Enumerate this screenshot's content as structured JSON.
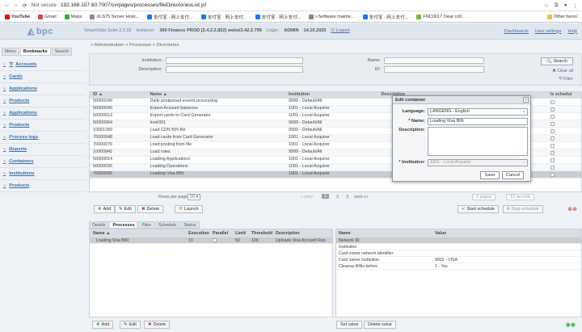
{
  "browser": {
    "warn": "Not secure",
    "url": "192.168.157.60:7007/sv/pages/processes/fileDirectoriesList.jsf",
    "other": "Other favori"
  },
  "bookmarks": [
    "YouTube",
    "Gmail",
    "Maps",
    "XLS75 Server Host...",
    "支付宝 · 网上支付...",
    "支付宝 · 网上支付...",
    "支付宝 · 网上支付...",
    "i-Software mainte...",
    "支付宝 · 网上支付...",
    "FNC0017 Dear coll..."
  ],
  "header": {
    "logo": "bpc",
    "suite": "SmartVista Suite 2.2.22",
    "instance_l": "Instance:",
    "instance": "360 Finance PROD [2.4.2.2.822] webs/2.42.2.795",
    "login_l": "Login:",
    "login": "ADMIN",
    "date": "14.10.2025",
    "logout": "Logout",
    "dashboards": "Dashboards",
    "user_settings": "User settings",
    "help": "Help"
  },
  "sidebar": {
    "tabs": [
      "Menu",
      "Bookmarks",
      "Search"
    ],
    "items": [
      "Accounts",
      "Cards",
      "Applications",
      "Products",
      "Applications",
      "Products",
      "Process logs",
      "Reports",
      "Containers",
      "Institutions",
      "Products"
    ]
  },
  "breadcrumb": "> Administration > Processes > Directories",
  "filter": {
    "institution": "Institution:",
    "description": "Description:",
    "name": "Name:",
    "id": "ID:",
    "search": "Search",
    "clear": "Clear all",
    "filter": "Filter"
  },
  "grid": {
    "headers": [
      "ID ▲",
      "Name ▲",
      "Institution",
      "Description",
      "Is schedul"
    ],
    "rows": [
      [
        "50000240",
        "Daily postponed events processing",
        "9999 - Default/All"
      ],
      [
        "50000040",
        "Export Account balances",
        "1001 - Local Acquirer"
      ],
      [
        "50000013",
        "Export cards to Card Generator",
        "1001 - Local Acquirer"
      ],
      [
        "50000064",
        "Instr001",
        "9999 - Default/All"
      ],
      [
        "10001289",
        "Load CDN BIN file",
        "9999 - Default/All"
      ],
      [
        "70000048",
        "Load cards from Card Generator",
        "1001 - Local Acquirer"
      ],
      [
        "70000076",
        "Load posting from file",
        "1001 - Local Acquirer"
      ],
      [
        "10000942",
        "Load roles",
        "9999 - Default/All"
      ],
      [
        "50000014",
        "Loading Applications",
        "1001 - Local Acquirer"
      ],
      [
        "50000036",
        "Loading Operations",
        "1001 - Local Acquirer"
      ],
      [
        "70000095",
        "Loading Visa BIN",
        "1001 - Local Acquirer"
      ]
    ]
  },
  "pager": {
    "rows_l": "Rows per page",
    "rows": "20",
    "prev": "« prev",
    "p1": "1",
    "p2": "2",
    "p3": "3",
    "next": "next »»",
    "pages": "pages",
    "records": "records",
    "pages_v": "2",
    "records_v": "12"
  },
  "toolbar": {
    "add": "Add",
    "edit": "Edit",
    "delete": "Delete",
    "launch": "Launch",
    "start": "Start schedule",
    "stop": "Stop schedule"
  },
  "dtabs": [
    "Details",
    "Processes",
    "Files",
    "Schedule",
    "Status"
  ],
  "dleft": {
    "headers": [
      "Name ▲",
      "Execution",
      "Parallel",
      "Limit",
      "Threshold",
      "Description"
    ],
    "row": [
      "Loading Visa BIN",
      "10",
      "",
      "50",
      "100",
      "Uploade Visa Account Ran"
    ]
  },
  "dright": {
    "headers": [
      "Name",
      "Value"
    ],
    "rows": [
      [
        "Network ID",
        ""
      ],
      [
        "Institution",
        ""
      ],
      [
        "Card owner network identifier",
        ""
      ],
      [
        "Card owner institution",
        "9002 - VISA"
      ],
      [
        "Cleanup BINs before",
        "1 - Yes"
      ]
    ]
  },
  "bottom": {
    "add": "Add",
    "edit": "Edit",
    "delete": "Delete",
    "set": "Set value",
    "del": "Delete value"
  },
  "dialog": {
    "title": "Edit container",
    "lang_l": "Language:",
    "lang": "LANGENG - English",
    "name_l": "* Name:",
    "name": "Loading Visa BIN",
    "desc_l": "Description:",
    "inst_l": "* Institution:",
    "inst": "1001 - Local Acquirer",
    "save": "Save",
    "cancel": "Cancel"
  },
  "colors": {
    "link": "#3e6ea5",
    "header": "#dfe6ee"
  }
}
